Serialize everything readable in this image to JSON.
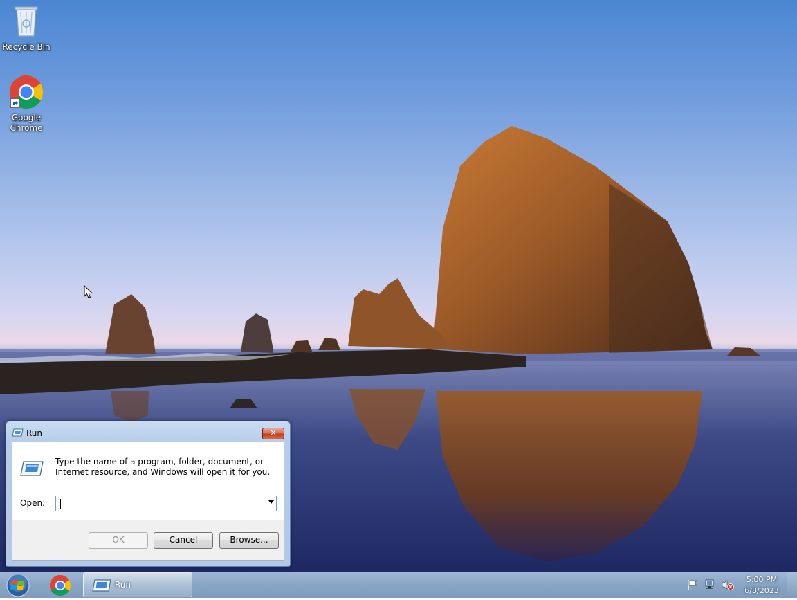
{
  "desktop": {
    "icons": [
      {
        "label": "Recycle Bin",
        "icon": "recycle-bin-icon"
      },
      {
        "label": "Google\nChrome",
        "icon": "chrome-icon"
      }
    ]
  },
  "run_dialog": {
    "title": "Run",
    "close_symbol": "✕",
    "description": "Type the name of a program, folder, document, or Internet resource, and Windows will open it for you.",
    "open_label": "Open:",
    "open_value": "",
    "ok_label": "OK",
    "cancel_label": "Cancel",
    "browse_label": "Browse..."
  },
  "taskbar": {
    "start_icon": "windows-start-orb",
    "pinned": [
      {
        "icon": "chrome-icon"
      }
    ],
    "active_window_label": "Run",
    "tray_icons": [
      "action-center-flag-icon",
      "network-icon",
      "volume-muted-icon"
    ],
    "time": "5:00 PM",
    "date": "6/8/2023"
  },
  "colors": {
    "sky_top": "#4a86d2",
    "taskbar": "#8aa6c7",
    "close_button": "#c2401f"
  }
}
